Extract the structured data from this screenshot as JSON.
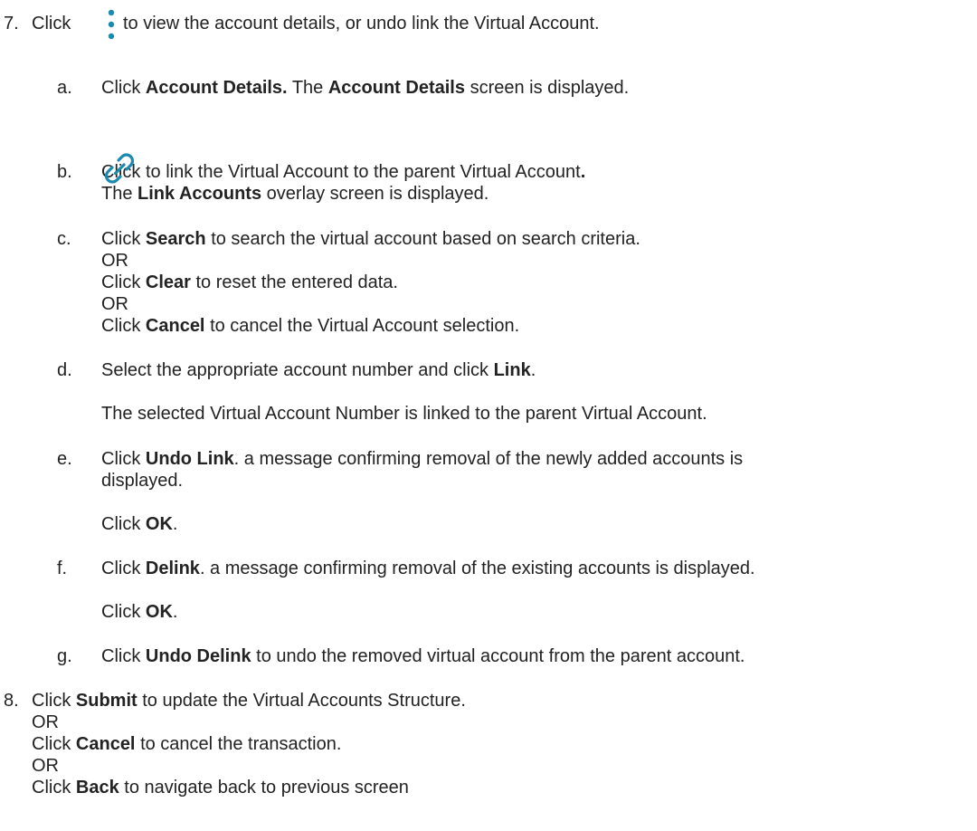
{
  "step7": {
    "number": "7.",
    "click": "Click",
    "text": "to view the account details, or undo link the Virtual Account.",
    "icon": "kebab-menu-icon"
  },
  "sub_a": {
    "letter": "a.",
    "click": "Click",
    "b1": "Account Details.",
    "mid": "The",
    "b2": "Account Details",
    "end": "screen is displayed."
  },
  "sub_b": {
    "letter": "b.",
    "click": "Click",
    "icon": "link-icon",
    "icon_color": "#1b8ab0",
    "text": "to link the Virtual Account to the parent Virtual Account",
    "period": ".",
    "l2_pre": "The",
    "l2_bold": "Link Accounts",
    "l2_post": "overlay screen is displayed."
  },
  "sub_c": {
    "letter": "c.",
    "click": "Click",
    "b1": "Search",
    "t1": "to search the virtual account based on search criteria.",
    "or1": "OR",
    "click2": "Click",
    "b2": "Clear",
    "t2": "to reset the entered data.",
    "or2": "OR",
    "click3": "Click",
    "b3": "Cancel",
    "t3": "to cancel the Virtual Account selection."
  },
  "sub_d": {
    "letter": "d.",
    "pre": "Select the appropriate account number and click",
    "b1": "Link",
    "post": ".",
    "note": "The selected Virtual Account Number is linked to the parent Virtual Account."
  },
  "sub_e": {
    "letter": "e.",
    "click": "Click",
    "b1": "Undo Link",
    "t1": ". a message confirming removal of the newly added accounts is",
    "t2": "displayed.",
    "ok_click": "Click",
    "ok": "OK",
    "ok_post": "."
  },
  "sub_f": {
    "letter": "f.",
    "click": "Click",
    "b1": "Delink",
    "t1": ". a message confirming removal of the existing accounts is displayed.",
    "ok_click": "Click",
    "ok": "OK",
    "ok_post": "."
  },
  "sub_g": {
    "letter": "g.",
    "click": "Click",
    "b1": "Undo Delink",
    "t1": "to undo the removed virtual account from the parent account."
  },
  "step8": {
    "number": "8.",
    "click": "Click",
    "b1": "Submit",
    "t1": "to update the Virtual Accounts Structure.",
    "or1": "OR",
    "click2": "Click",
    "b2": "Cancel",
    "t2": "to cancel the transaction.",
    "or2": "OR",
    "click3": "Click",
    "b3": "Back",
    "t3": "to navigate back to previous screen"
  }
}
